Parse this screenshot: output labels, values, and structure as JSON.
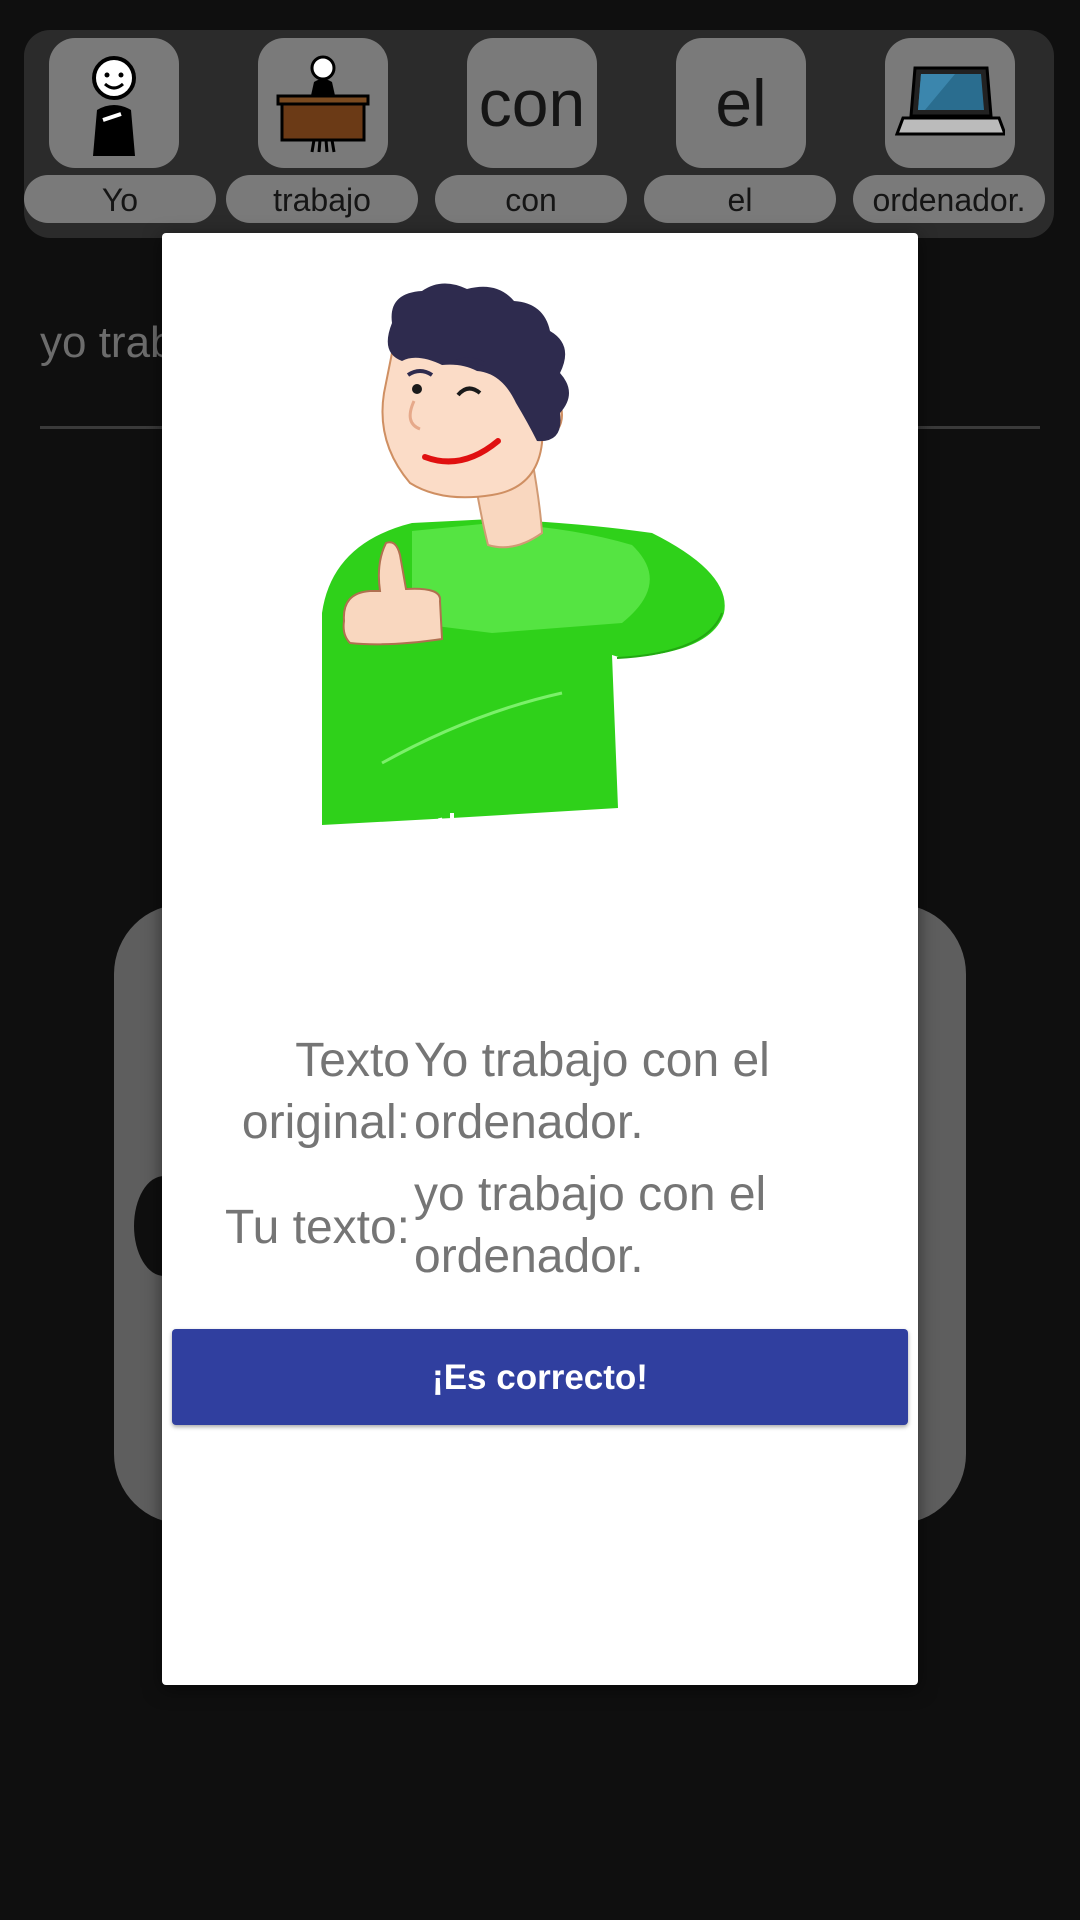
{
  "pictogram_bar": {
    "items": [
      {
        "word": "Yo",
        "icon": "person-pointing-self-icon",
        "symbol": ""
      },
      {
        "word": "trabajo",
        "icon": "person-working-at-desk-icon",
        "symbol": ""
      },
      {
        "word": "con",
        "icon": "text-symbol",
        "symbol": "con"
      },
      {
        "word": "el",
        "icon": "text-symbol",
        "symbol": "el"
      },
      {
        "word": "ordenador.",
        "icon": "laptop-icon",
        "symbol": ""
      }
    ]
  },
  "input": {
    "text": "yo trabajo con el ordenador."
  },
  "dialog": {
    "illustration": "thumbs-up-winking-man-icon",
    "original_label": "Texto original:",
    "original_text": "Yo trabajo con el ordenador.",
    "yours_label": "Tu texto:",
    "yours_text": "yo trabajo con el ordenador.",
    "button_label": "¡Es correcto!"
  },
  "colors": {
    "button": "#303f9f",
    "background": "#0f0f0f",
    "card": "#7a7a7a",
    "shirt": "#34d11e"
  }
}
